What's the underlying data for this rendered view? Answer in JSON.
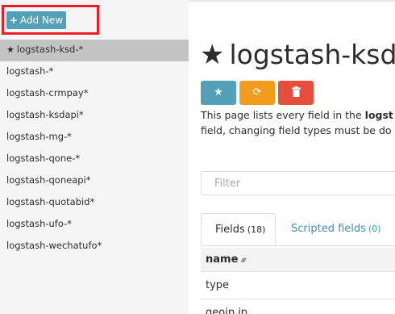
{
  "sidebar": {
    "add_new_label": "Add New",
    "patterns": [
      {
        "label": "logstash-ksd-*",
        "active": true,
        "starred": true
      },
      {
        "label": "logstash-*",
        "active": false,
        "starred": false
      },
      {
        "label": "logstash-crmpay*",
        "active": false,
        "starred": false
      },
      {
        "label": "logstash-ksdapi*",
        "active": false,
        "starred": false
      },
      {
        "label": "logstash-mg-*",
        "active": false,
        "starred": false
      },
      {
        "label": "logstash-qone-*",
        "active": false,
        "starred": false
      },
      {
        "label": "logstash-qoneapi*",
        "active": false,
        "starred": false
      },
      {
        "label": "logstash-quotabid*",
        "active": false,
        "starred": false
      },
      {
        "label": "logstash-ufo-*",
        "active": false,
        "starred": false
      },
      {
        "label": "logstash-wechatufo*",
        "active": false,
        "starred": false
      }
    ]
  },
  "main": {
    "title": "logstash-ksd",
    "description_line1_prefix": "This page lists every field in the ",
    "description_line1_bold": "logst",
    "description_line2": "field, changing field types must be do",
    "filter_placeholder": "Filter",
    "tabs": [
      {
        "label": "Fields",
        "count": "(18)"
      },
      {
        "label": "Scripted fields",
        "count": "(0)"
      }
    ],
    "table": {
      "column_name": "name",
      "rows": [
        "type",
        "geoip.ip"
      ]
    }
  },
  "colors": {
    "accent_blue": "#54a0b8",
    "accent_orange": "#f29b1d",
    "accent_red": "#e54d3d",
    "highlight_box": "#ec1c2b",
    "link_blue": "#3f8fc0"
  },
  "icons": {
    "add": "plus-icon",
    "default_pattern": "star-icon",
    "set_default": "star-icon",
    "refresh": "refresh-icon",
    "delete": "trash-icon",
    "sort": "sort-icon"
  }
}
